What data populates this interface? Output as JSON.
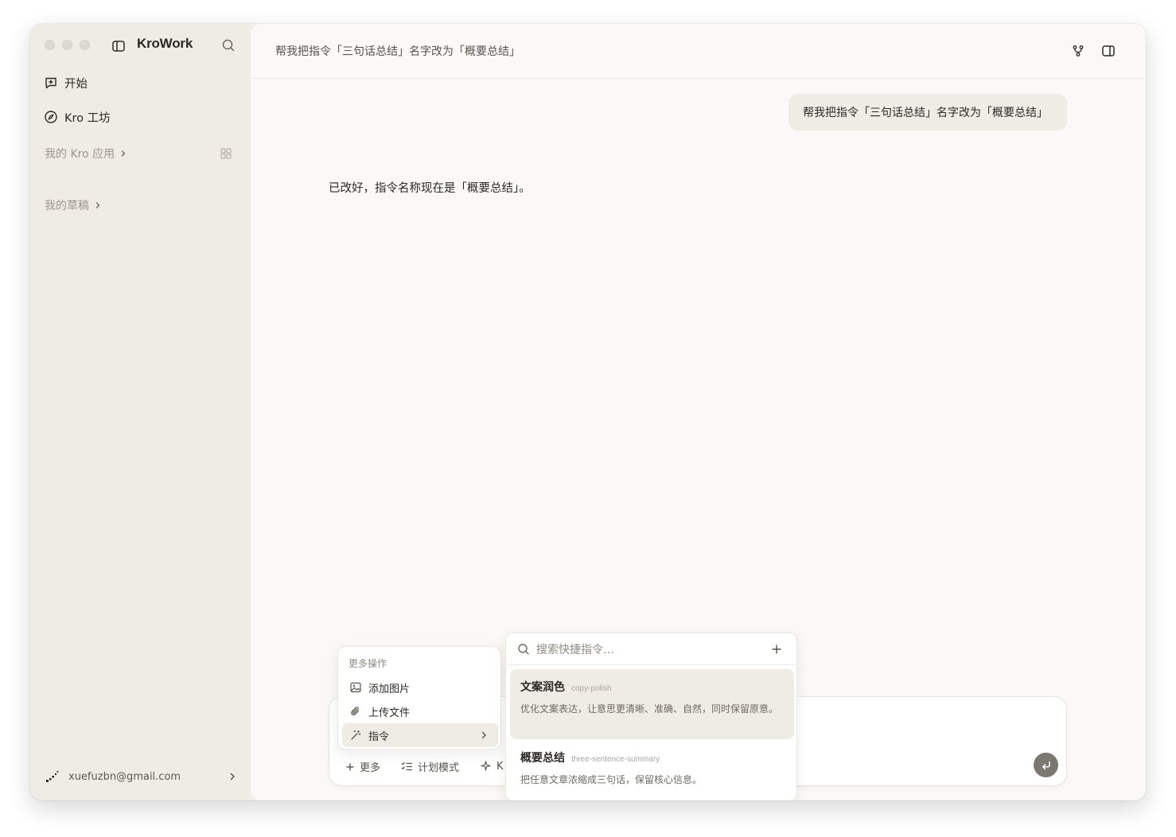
{
  "app": {
    "name": "KroWork"
  },
  "sidebar": {
    "nav": [
      {
        "label": "开始",
        "icon": "new-chat-icon"
      },
      {
        "label": "Kro 工坊",
        "icon": "compass-icon"
      }
    ],
    "groups": [
      {
        "label": "我的 Kro 应用"
      },
      {
        "label": "我的草稿"
      }
    ],
    "account": {
      "email": "xuefuzbn@gmail.com"
    }
  },
  "header": {
    "title": "帮我把指令「三句话总结」名字改为「概要总结」"
  },
  "conversation": {
    "user_message": "帮我把指令「三句话总结」名字改为「概要总结」",
    "assistant_message": "已改好，指令名称现在是「概要总结」。"
  },
  "composer": {
    "more_label": "更多",
    "plan_label": "计划模式",
    "partial_label": "K"
  },
  "more_menu": {
    "header": "更多操作",
    "items": [
      {
        "label": "添加图片",
        "icon": "image-icon"
      },
      {
        "label": "上传文件",
        "icon": "paperclip-icon"
      },
      {
        "label": "指令",
        "icon": "magic-wand-icon"
      }
    ]
  },
  "command_palette": {
    "placeholder": "搜索快捷指令…",
    "commands": [
      {
        "name": "文案润色",
        "slug": "copy-polish",
        "description": "优化文案表达，让意思更清晰、准确、自然，同时保留原意。"
      },
      {
        "name": "概要总结",
        "slug": "three-sentence-summary",
        "description": "把任意文章浓缩成三句话，保留核心信息。"
      }
    ]
  },
  "colors": {
    "sidebar_bg": "#efece6",
    "main_bg": "#faf9f7",
    "send_button": "#7b7872"
  }
}
